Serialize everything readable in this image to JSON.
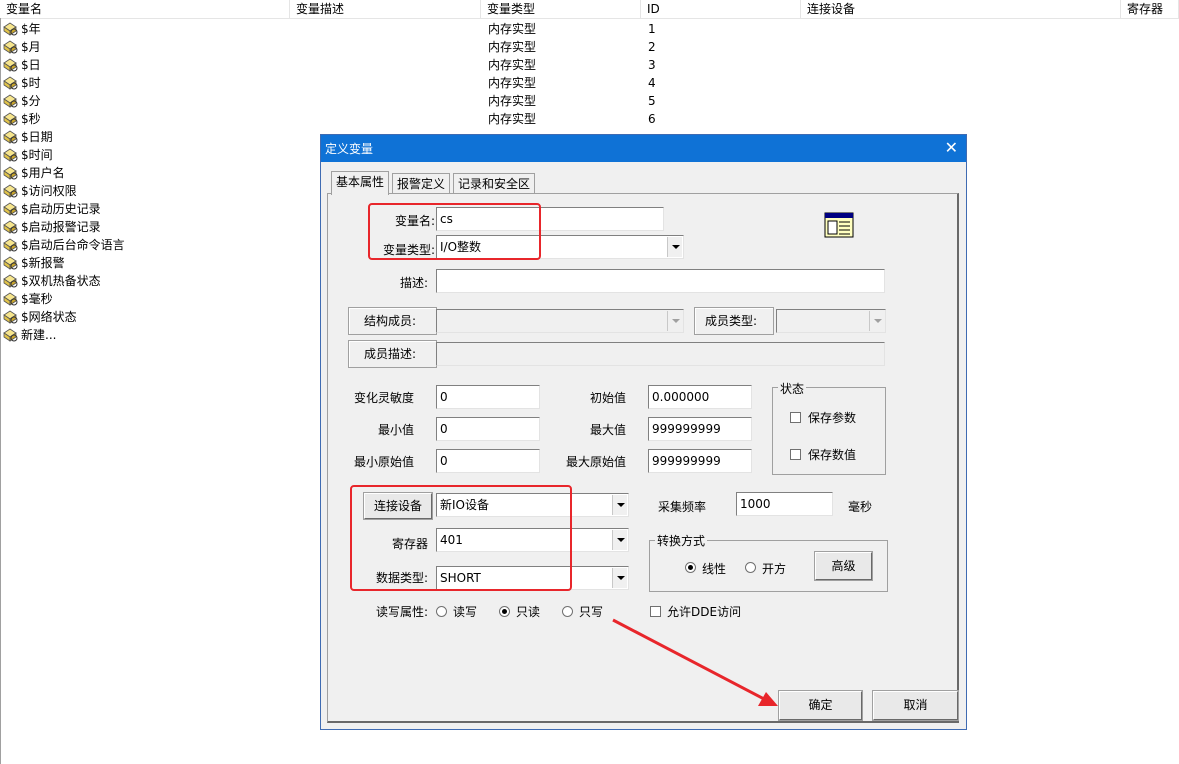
{
  "list": {
    "columns": [
      "变量名",
      "变量描述",
      "变量类型",
      "ID",
      "连接设备",
      "寄存器"
    ],
    "rows": [
      {
        "name": "$年",
        "type": "内存实型",
        "id": "1"
      },
      {
        "name": "$月",
        "type": "内存实型",
        "id": "2"
      },
      {
        "name": "$日",
        "type": "内存实型",
        "id": "3"
      },
      {
        "name": "$时",
        "type": "内存实型",
        "id": "4"
      },
      {
        "name": "$分",
        "type": "内存实型",
        "id": "5"
      },
      {
        "name": "$秒",
        "type": "内存实型",
        "id": "6"
      },
      {
        "name": "$日期"
      },
      {
        "name": "$时间"
      },
      {
        "name": "$用户名"
      },
      {
        "name": "$访问权限"
      },
      {
        "name": "$启动历史记录"
      },
      {
        "name": "$启动报警记录"
      },
      {
        "name": "$启动后台命令语言"
      },
      {
        "name": "$新报警"
      },
      {
        "name": "$双机热备状态"
      },
      {
        "name": "$毫秒"
      },
      {
        "name": "$网络状态"
      },
      {
        "name": "新建..."
      }
    ]
  },
  "dialog": {
    "title": "定义变量",
    "close_glyph": "✕",
    "tabs": [
      "基本属性",
      "报警定义",
      "记录和安全区"
    ],
    "var_name_label": "变量名:",
    "var_name_value": "cs",
    "var_type_label": "变量类型:",
    "var_type_value": "I/O整数",
    "desc_label": "描述:",
    "desc_value": "",
    "struct_member_label": "结构成员:",
    "member_type_label": "成员类型:",
    "member_desc_label": "成员描述:",
    "sensitivity_label": "变化灵敏度",
    "sensitivity_value": "0",
    "min_label": "最小值",
    "min_value": "0",
    "min_raw_label": "最小原始值",
    "min_raw_value": "0",
    "init_label": "初始值",
    "init_value": "0.000000",
    "max_label": "最大值",
    "max_value": "999999999",
    "max_raw_label": "最大原始值",
    "max_raw_value": "999999999",
    "status_group": "状态",
    "save_params_label": "保存参数",
    "save_values_label": "保存数值",
    "connect_device_button": "连接设备",
    "connect_device_value": "新IO设备",
    "register_label": "寄存器",
    "register_value": "401",
    "data_type_label": "数据类型:",
    "data_type_value": "SHORT",
    "sample_rate_label": "采集频率",
    "sample_rate_value": "1000",
    "ms_label": "毫秒",
    "convert_group": "转换方式",
    "linear_label": "线性",
    "sqrt_label": "开方",
    "advanced_button": "高级",
    "rw_label": "读写属性:",
    "read_write_label": "读写",
    "read_only_label": "只读",
    "write_only_label": "只写",
    "dde_label": "允许DDE访问",
    "ok_button": "确定",
    "cancel_button": "取消"
  },
  "colors": {
    "titlebar": "#0f72d6",
    "annotation": "#e8262b"
  }
}
